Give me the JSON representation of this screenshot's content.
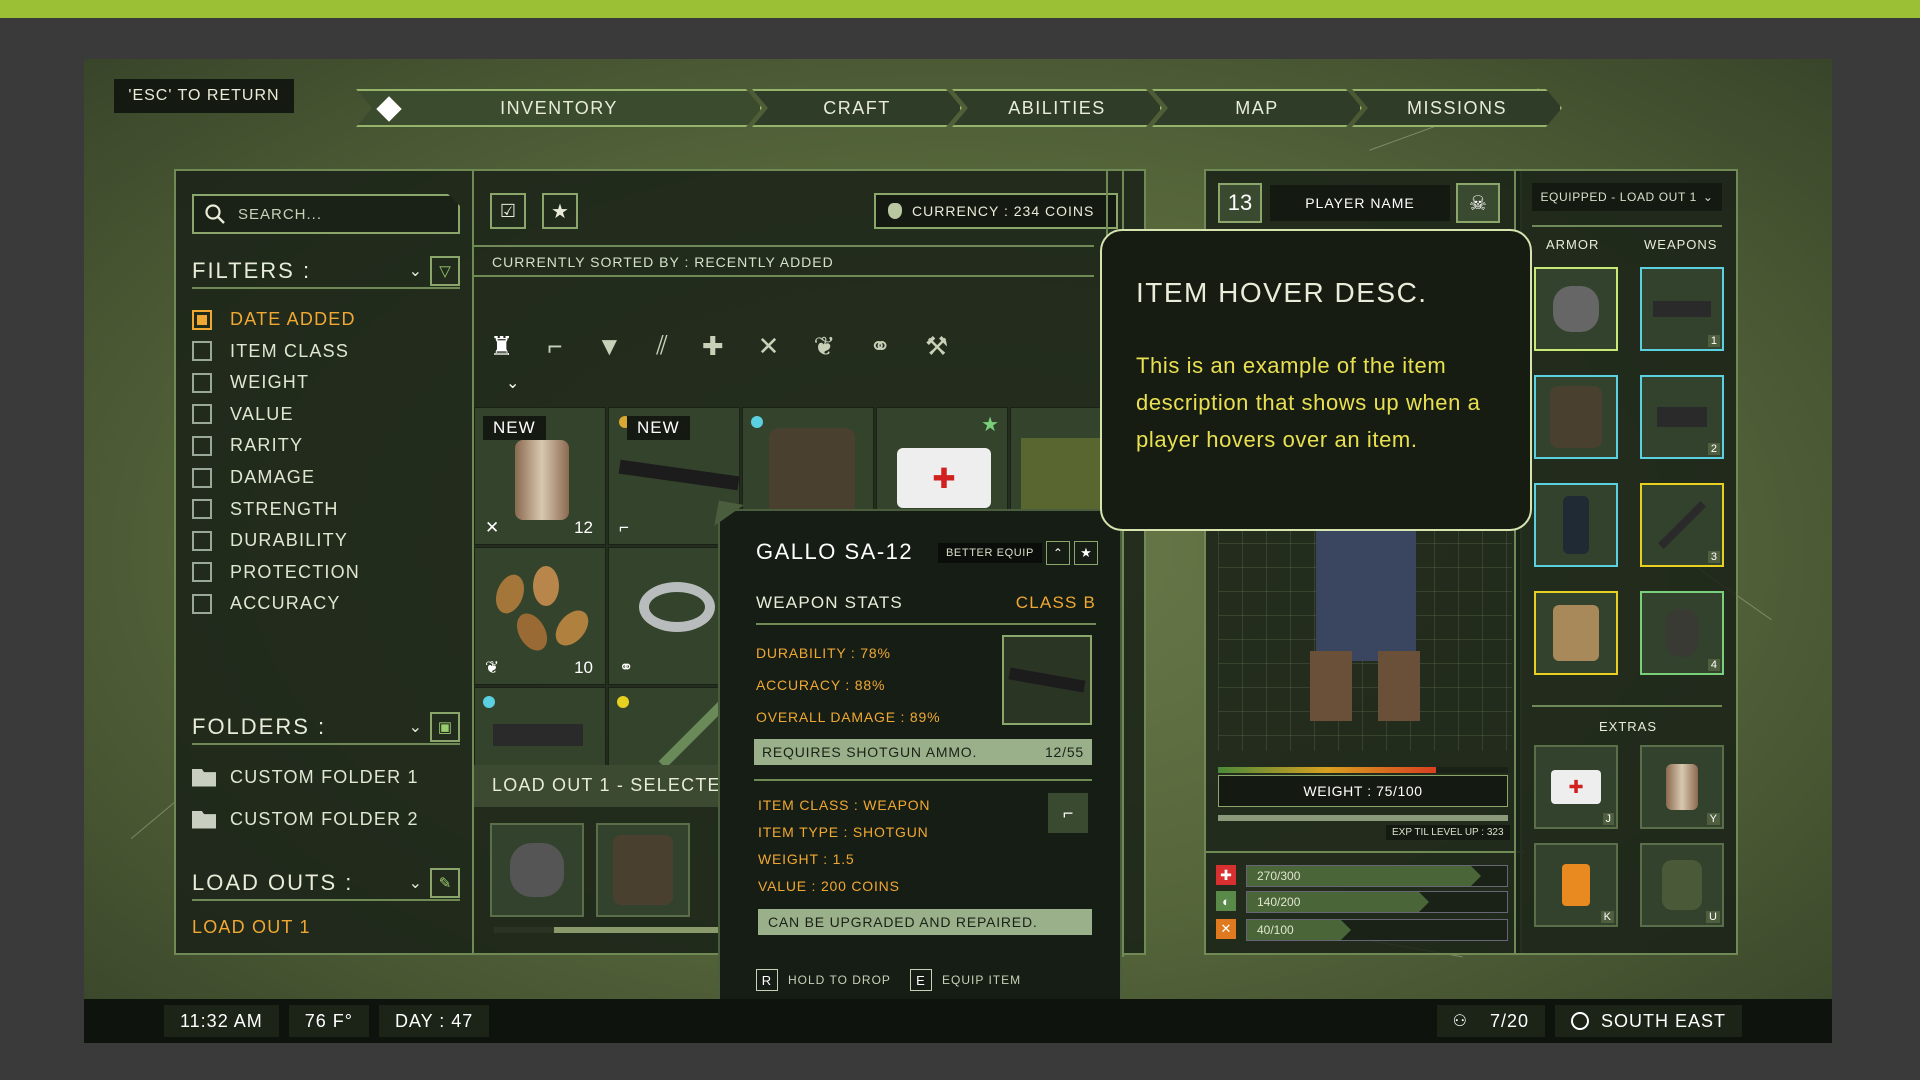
{
  "nav": {
    "esc_label": "'ESC' TO RETURN",
    "tabs": [
      {
        "label": "INVENTORY"
      },
      {
        "label": "CRAFT"
      },
      {
        "label": "ABILITIES"
      },
      {
        "label": "MAP"
      },
      {
        "label": "MISSIONS"
      }
    ]
  },
  "left_panel": {
    "search_placeholder": "SEARCH...",
    "filters_title": "FILTERS :",
    "filters": [
      "DATE ADDED",
      "ITEM CLASS",
      "WEIGHT",
      "VALUE",
      "RARITY",
      "DAMAGE",
      "STRENGTH",
      "DURABILITY",
      "PROTECTION",
      "ACCURACY"
    ],
    "folders_title": "FOLDERS :",
    "folders": [
      "CUSTOM FOLDER 1",
      "CUSTOM FOLDER 2"
    ],
    "loadouts_title": "LOAD OUTS :",
    "loadout_item": "LOAD OUT 1"
  },
  "center": {
    "currency": "CURRENCY : 234 COINS",
    "sorted_by": "CURRENTLY SORTED BY : RECENTLY ADDED",
    "new_label": "NEW",
    "item_qty_1": "12",
    "item_qty_2": "10",
    "loadout_selected": "LOAD OUT 1 - SELECTED"
  },
  "item_popup": {
    "name": "GALLO SA-12",
    "better_equip": "BETTER EQUIP",
    "stats_title": "WEAPON STATS",
    "class": "CLASS B",
    "durability": "DURABILITY : 78%",
    "accuracy": "ACCURACY : 88%",
    "overall_damage": "OVERALL DAMAGE : 89%",
    "ammo_req": "REQUIRES SHOTGUN AMMO.",
    "ammo_count": "12/55",
    "item_class": "ITEM CLASS : WEAPON",
    "item_type": "ITEM TYPE : SHOTGUN",
    "weight": "WEIGHT : 1.5",
    "value": "VALUE : 200 COINS",
    "upgrade_note": "CAN BE UPGRADED AND REPAIRED.",
    "drop_key": "R",
    "drop_label": "HOLD TO DROP",
    "equip_key": "E",
    "equip_label": "EQUIP ITEM"
  },
  "hover_desc": {
    "title": "ITEM HOVER DESC.",
    "body": "This is an example of the item description that shows up when a player hovers over an item."
  },
  "player": {
    "level": "13",
    "name": "PLAYER NAME",
    "weight": "WEIGHT : 75/100",
    "exp_label": "EXP TIL LEVEL UP : 323",
    "health": "270/300",
    "health_frac": 0.9,
    "stamina": "140/200",
    "stamina_frac": 0.7,
    "hunger": "40/100",
    "hunger_frac": 0.4,
    "weight_frac": 0.75
  },
  "equipped": {
    "dropdown": "EQUIPPED - LOAD OUT 1",
    "armor_title": "ARMOR",
    "weapons_title": "WEAPONS",
    "extras_title": "EXTRAS",
    "weapon_slots": [
      "1",
      "2",
      "3",
      "4"
    ],
    "extra_keys": [
      "J",
      "Y",
      "K",
      "U"
    ]
  },
  "status_bar": {
    "time": "11:32 AM",
    "temp": "76 F°",
    "day": "DAY : 47",
    "players": "7/20",
    "direction": "SOUTH EAST"
  },
  "colors": {
    "accent_green": "#9bbf35",
    "accent_orange": "#f0a833",
    "hover_yellow": "#e8e050"
  }
}
